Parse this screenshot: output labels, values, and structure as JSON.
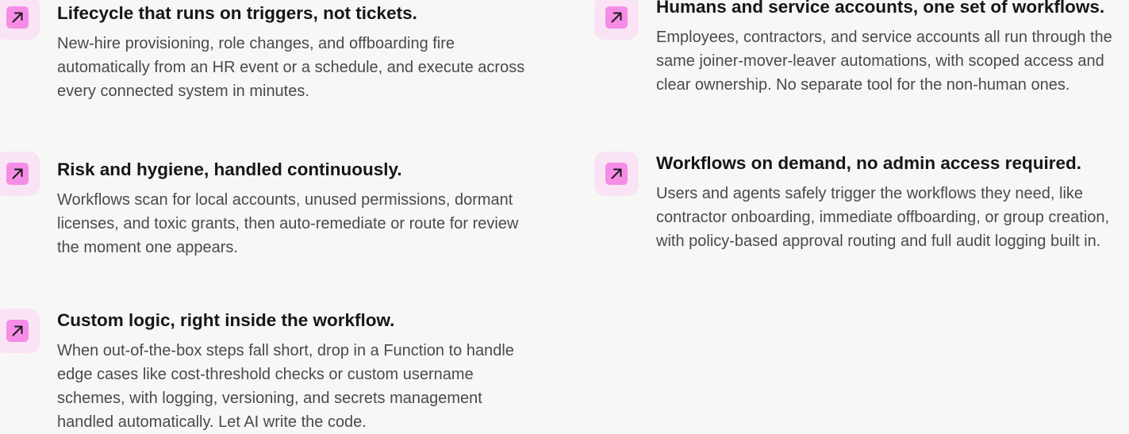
{
  "features": [
    {
      "title": "Lifecycle that runs on triggers, not tickets.",
      "body": "New-hire provisioning, role changes, and offboarding fire automatically from an HR event or a schedule, and execute across every connected system in minutes."
    },
    {
      "title": "Risk and hygiene, handled continuously.",
      "body": "Workflows scan for local accounts, unused permissions, dormant licenses, and toxic grants, then auto-remediate or route for review the moment one appears."
    },
    {
      "title": "Custom logic, right inside the workflow.",
      "body": "When out-of-the-box steps fall short, drop in a Function to handle edge cases like cost-threshold checks or custom username schemes, with logging, versioning, and secrets management handled automatically. Let AI write the code."
    },
    {
      "title": "Humans and service accounts, one set of workflows.",
      "body": "Employees, contractors, and service accounts all run through the same joiner-mover-leaver automations, with scoped access and clear ownership. No separate tool for the non-human ones."
    },
    {
      "title": "Workflows on demand, no admin access required.",
      "body": "Users and agents safely trigger the workflows they need, like contractor onboarding, immediate offboarding, or group creation, with policy-based approval routing and full audit logging built in."
    }
  ],
  "icon": {
    "name": "arrow-up-right-icon",
    "tile_color": "#fae3f5",
    "badge_color": "#f58de6",
    "stroke_color": "#1a1a1a"
  }
}
